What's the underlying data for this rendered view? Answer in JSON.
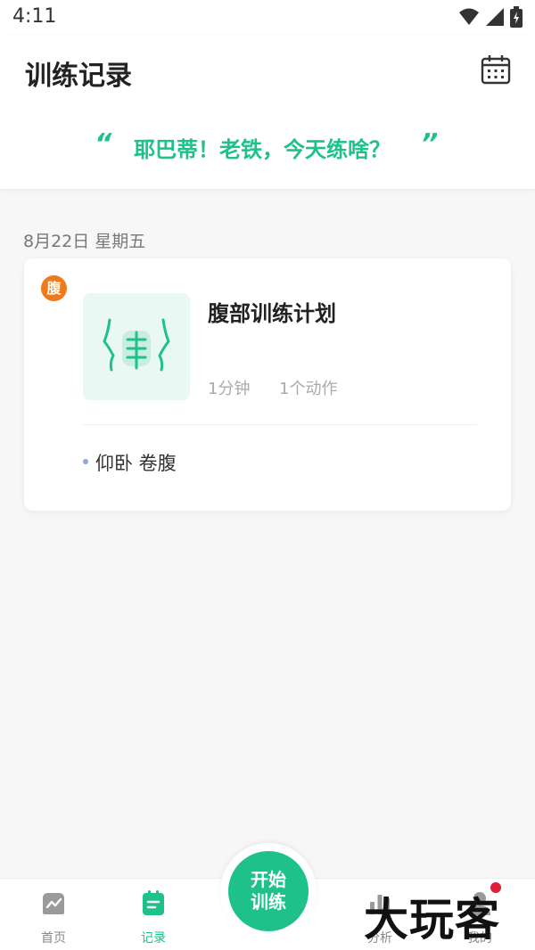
{
  "status_bar": {
    "time": "4:11"
  },
  "header": {
    "title": "训练记录",
    "quote_open": "“",
    "quote_text": "耶巴蒂！老铁，今天练啥？",
    "quote_close": "”"
  },
  "records": {
    "date": "8月22日 星期五",
    "card": {
      "badge": "腹",
      "plan_title": "腹部训练计划",
      "duration": "1分钟",
      "actions": "1个动作",
      "exercises": [
        "仰卧 卷腹"
      ]
    }
  },
  "tabbar": {
    "home": "首页",
    "records": "记录",
    "start_line1": "开始",
    "start_line2": "训练",
    "analysis": "分析",
    "mine": "我的"
  },
  "watermark": "大玩客",
  "colors": {
    "accent": "#1fc18a",
    "badge": "#f07a1a",
    "dot": "#8ea6e8"
  }
}
